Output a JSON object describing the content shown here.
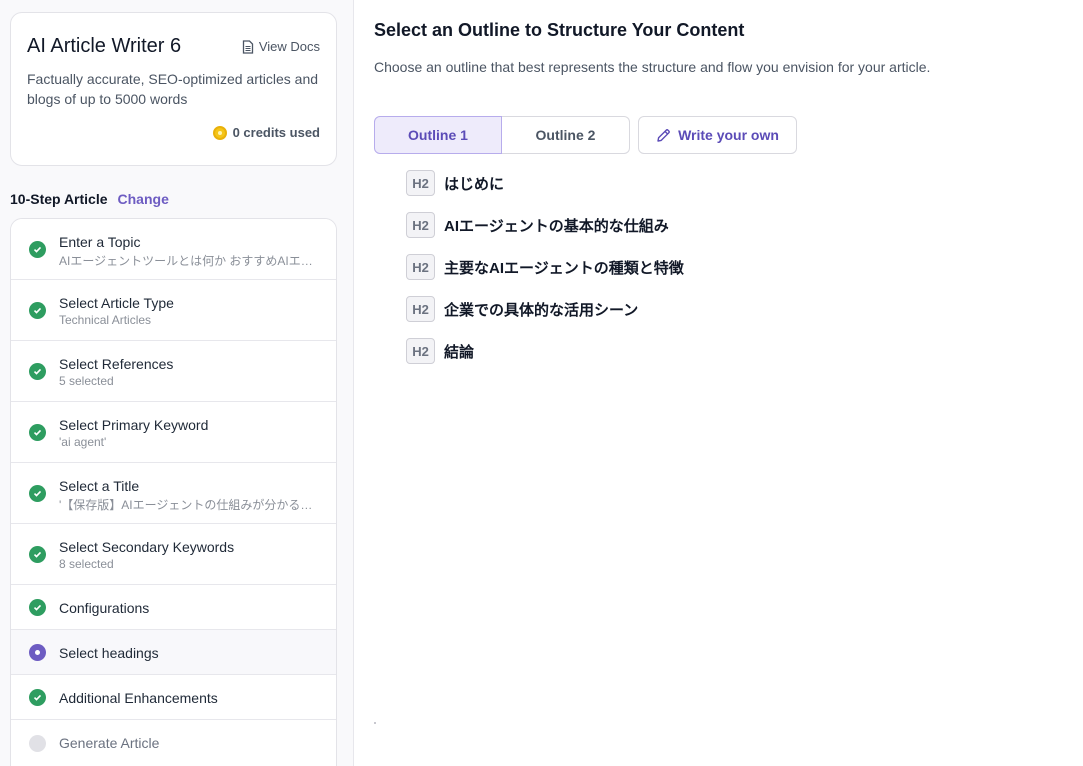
{
  "tool": {
    "title": "AI Article Writer 6",
    "view_docs": "View Docs",
    "description": "Factually accurate, SEO-optimized articles and blogs of up to 5000 words",
    "credits": "0 credits used"
  },
  "flow": {
    "name": "10-Step Article",
    "change": "Change"
  },
  "steps": [
    {
      "label": "Enter a Topic",
      "sub": "AIエージェントツールとは何か おすすめAIエ…",
      "status": "done"
    },
    {
      "label": "Select Article Type",
      "sub": "Technical Articles",
      "status": "done"
    },
    {
      "label": "Select References",
      "sub": "5 selected",
      "status": "done"
    },
    {
      "label": "Select Primary Keyword",
      "sub": "'ai agent'",
      "status": "done"
    },
    {
      "label": "Select a Title",
      "sub": "'【保存版】AIエージェントの仕組みが分かる…",
      "status": "done"
    },
    {
      "label": "Select Secondary Keywords",
      "sub": "8 selected",
      "status": "done"
    },
    {
      "label": "Configurations",
      "sub": "",
      "status": "done"
    },
    {
      "label": "Select headings",
      "sub": "",
      "status": "current"
    },
    {
      "label": "Additional Enhancements",
      "sub": "",
      "status": "done"
    },
    {
      "label": "Generate Article",
      "sub": "",
      "status": "pending"
    }
  ],
  "main": {
    "title": "Select an Outline to Structure Your Content",
    "subtitle": "Choose an outline that best represents the structure and flow you envision for your article.",
    "tabs": [
      "Outline 1",
      "Outline 2"
    ],
    "active_tab": "Outline 1",
    "write_own": "Write your own",
    "headings": [
      {
        "level": "H2",
        "text": "はじめに"
      },
      {
        "level": "H2",
        "text": "AIエージェントの基本的な仕組み"
      },
      {
        "level": "H2",
        "text": "主要なAIエージェントの種類と特徴"
      },
      {
        "level": "H2",
        "text": "企業での具体的な活用シーン"
      },
      {
        "level": "H2",
        "text": "結論"
      }
    ]
  },
  "colors": {
    "accent": "#6d5cc2",
    "done": "#2e9d60",
    "pending": "#e1e1e6"
  }
}
